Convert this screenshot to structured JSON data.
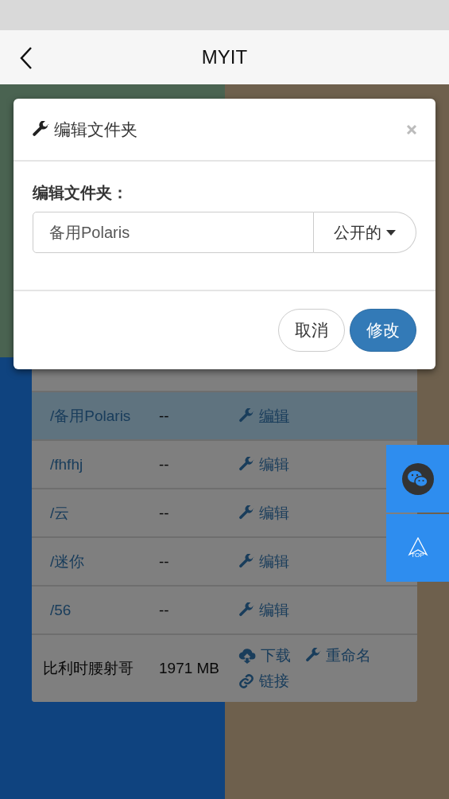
{
  "header": {
    "title": "MYIT"
  },
  "table": {
    "rows": [
      {
        "kind": "folder",
        "name": "/备用Polaris",
        "size": "--",
        "selected": true,
        "actions": [
          {
            "kind": "edit",
            "label": "编辑"
          }
        ]
      },
      {
        "kind": "folder",
        "name": "/fhfhj",
        "size": "--",
        "selected": false,
        "actions": [
          {
            "kind": "edit",
            "label": "编辑"
          }
        ]
      },
      {
        "kind": "folder",
        "name": "/云",
        "size": "--",
        "selected": false,
        "actions": [
          {
            "kind": "edit",
            "label": "编辑"
          }
        ]
      },
      {
        "kind": "folder",
        "name": "/迷你",
        "size": "--",
        "selected": false,
        "actions": [
          {
            "kind": "edit",
            "label": "编辑"
          }
        ]
      },
      {
        "kind": "folder",
        "name": "/56",
        "size": "--",
        "selected": false,
        "actions": [
          {
            "kind": "edit",
            "label": "编辑"
          }
        ]
      },
      {
        "kind": "file",
        "name": "比利时腰射哥",
        "size": "1971 MB",
        "selected": false,
        "actions": [
          {
            "kind": "download",
            "label": "下载"
          },
          {
            "kind": "rename",
            "label": "重命名"
          },
          {
            "kind": "link",
            "label": "链接"
          }
        ]
      }
    ]
  },
  "dialog": {
    "title": "编辑文件夹",
    "field_label": "编辑文件夹：",
    "field_value": "备用Polaris",
    "visibility": "公开的",
    "buttons": [
      {
        "kind": "default",
        "label": "取消"
      },
      {
        "kind": "primary",
        "label": "修改"
      }
    ]
  },
  "float_buttons": [
    {
      "kind": "chat"
    },
    {
      "kind": "top",
      "label": "TOP"
    }
  ]
}
